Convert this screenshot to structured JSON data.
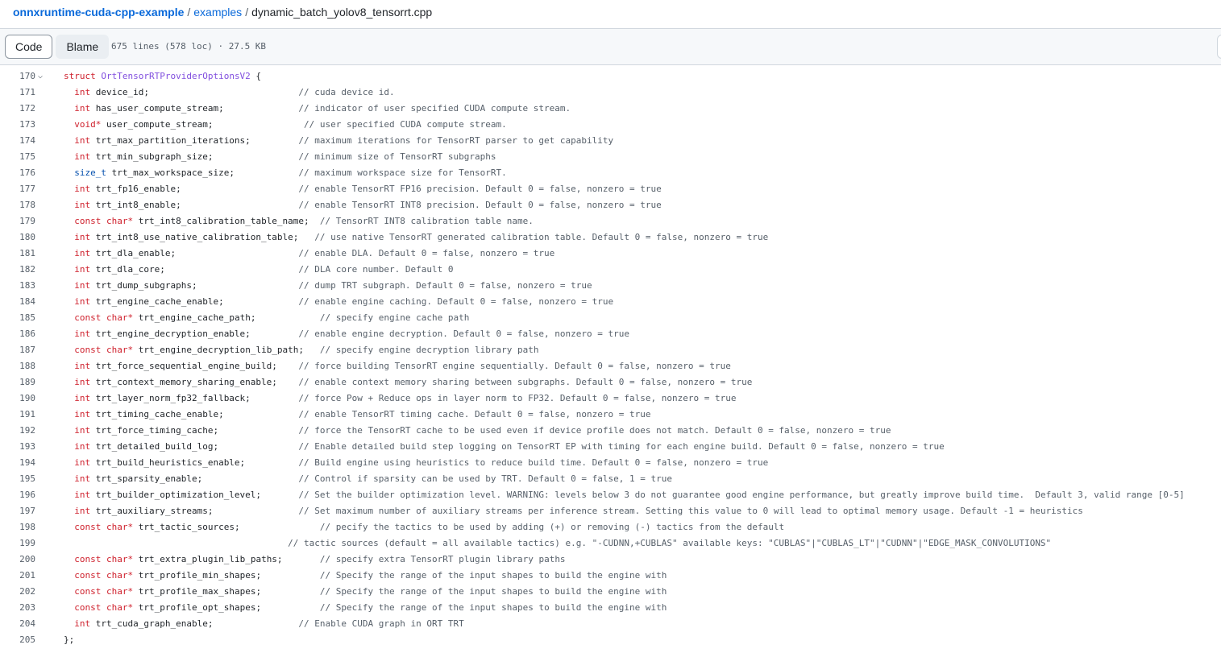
{
  "breadcrumb": {
    "repo": "onnxruntime-cuda-cpp-example",
    "separator": "/",
    "folder": "examples",
    "file": "dynamic_batch_yolov8_tensorrt.cpp"
  },
  "toolbar": {
    "code_label": "Code",
    "blame_label": "Blame",
    "file_meta": "675 lines (578 loc) · 27.5 KB"
  },
  "icons": {
    "fold": "chevron-down-icon"
  },
  "colors": {
    "keyword": "#cf222e",
    "entity": "#8250df",
    "type": "#0550ae",
    "comment": "#57606a",
    "link": "#0969da"
  },
  "code": {
    "lines": [
      {
        "n": "170",
        "tokens": [
          [
            "kw",
            "struct"
          ],
          [
            "t",
            " "
          ],
          [
            "ent",
            "OrtTensorRTProviderOptionsV2"
          ],
          [
            "t",
            " {"
          ]
        ]
      },
      {
        "n": "171",
        "tokens": [
          [
            "t",
            "  "
          ],
          [
            "kw",
            "int"
          ],
          [
            "t",
            " device_id;                            "
          ],
          [
            "cmt",
            "// cuda device id."
          ]
        ]
      },
      {
        "n": "172",
        "tokens": [
          [
            "t",
            "  "
          ],
          [
            "kw",
            "int"
          ],
          [
            "t",
            " has_user_compute_stream;              "
          ],
          [
            "cmt",
            "// indicator of user specified CUDA compute stream."
          ]
        ]
      },
      {
        "n": "173",
        "tokens": [
          [
            "t",
            "  "
          ],
          [
            "kw",
            "void"
          ],
          [
            "kw",
            "*"
          ],
          [
            "t",
            " user_compute_stream;                 "
          ],
          [
            "cmt",
            "// user specified CUDA compute stream."
          ]
        ]
      },
      {
        "n": "174",
        "tokens": [
          [
            "t",
            "  "
          ],
          [
            "kw",
            "int"
          ],
          [
            "t",
            " trt_max_partition_iterations;         "
          ],
          [
            "cmt",
            "// maximum iterations for TensorRT parser to get capability"
          ]
        ]
      },
      {
        "n": "175",
        "tokens": [
          [
            "t",
            "  "
          ],
          [
            "kw",
            "int"
          ],
          [
            "t",
            " trt_min_subgraph_size;                "
          ],
          [
            "cmt",
            "// minimum size of TensorRT subgraphs"
          ]
        ]
      },
      {
        "n": "176",
        "tokens": [
          [
            "t",
            "  "
          ],
          [
            "typ",
            "size_t"
          ],
          [
            "t",
            " trt_max_workspace_size;            "
          ],
          [
            "cmt",
            "// maximum workspace size for TensorRT."
          ]
        ]
      },
      {
        "n": "177",
        "tokens": [
          [
            "t",
            "  "
          ],
          [
            "kw",
            "int"
          ],
          [
            "t",
            " trt_fp16_enable;                      "
          ],
          [
            "cmt",
            "// enable TensorRT FP16 precision. Default 0 = false, nonzero = true"
          ]
        ]
      },
      {
        "n": "178",
        "tokens": [
          [
            "t",
            "  "
          ],
          [
            "kw",
            "int"
          ],
          [
            "t",
            " trt_int8_enable;                      "
          ],
          [
            "cmt",
            "// enable TensorRT INT8 precision. Default 0 = false, nonzero = true"
          ]
        ]
      },
      {
        "n": "179",
        "tokens": [
          [
            "t",
            "  "
          ],
          [
            "kw",
            "const"
          ],
          [
            "t",
            " "
          ],
          [
            "kw",
            "char"
          ],
          [
            "kw",
            "*"
          ],
          [
            "t",
            " trt_int8_calibration_table_name;  "
          ],
          [
            "cmt",
            "// TensorRT INT8 calibration table name."
          ]
        ]
      },
      {
        "n": "180",
        "tokens": [
          [
            "t",
            "  "
          ],
          [
            "kw",
            "int"
          ],
          [
            "t",
            " trt_int8_use_native_calibration_table;   "
          ],
          [
            "cmt",
            "// use native TensorRT generated calibration table. Default 0 = false, nonzero = true"
          ]
        ]
      },
      {
        "n": "181",
        "tokens": [
          [
            "t",
            "  "
          ],
          [
            "kw",
            "int"
          ],
          [
            "t",
            " trt_dla_enable;                       "
          ],
          [
            "cmt",
            "// enable DLA. Default 0 = false, nonzero = true"
          ]
        ]
      },
      {
        "n": "182",
        "tokens": [
          [
            "t",
            "  "
          ],
          [
            "kw",
            "int"
          ],
          [
            "t",
            " trt_dla_core;                         "
          ],
          [
            "cmt",
            "// DLA core number. Default 0"
          ]
        ]
      },
      {
        "n": "183",
        "tokens": [
          [
            "t",
            "  "
          ],
          [
            "kw",
            "int"
          ],
          [
            "t",
            " trt_dump_subgraphs;                   "
          ],
          [
            "cmt",
            "// dump TRT subgraph. Default 0 = false, nonzero = true"
          ]
        ]
      },
      {
        "n": "184",
        "tokens": [
          [
            "t",
            "  "
          ],
          [
            "kw",
            "int"
          ],
          [
            "t",
            " trt_engine_cache_enable;              "
          ],
          [
            "cmt",
            "// enable engine caching. Default 0 = false, nonzero = true"
          ]
        ]
      },
      {
        "n": "185",
        "tokens": [
          [
            "t",
            "  "
          ],
          [
            "kw",
            "const"
          ],
          [
            "t",
            " "
          ],
          [
            "kw",
            "char"
          ],
          [
            "kw",
            "*"
          ],
          [
            "t",
            " trt_engine_cache_path;            "
          ],
          [
            "cmt",
            "// specify engine cache path"
          ]
        ]
      },
      {
        "n": "186",
        "tokens": [
          [
            "t",
            "  "
          ],
          [
            "kw",
            "int"
          ],
          [
            "t",
            " trt_engine_decryption_enable;         "
          ],
          [
            "cmt",
            "// enable engine decryption. Default 0 = false, nonzero = true"
          ]
        ]
      },
      {
        "n": "187",
        "tokens": [
          [
            "t",
            "  "
          ],
          [
            "kw",
            "const"
          ],
          [
            "t",
            " "
          ],
          [
            "kw",
            "char"
          ],
          [
            "kw",
            "*"
          ],
          [
            "t",
            " trt_engine_decryption_lib_path;   "
          ],
          [
            "cmt",
            "// specify engine decryption library path"
          ]
        ]
      },
      {
        "n": "188",
        "tokens": [
          [
            "t",
            "  "
          ],
          [
            "kw",
            "int"
          ],
          [
            "t",
            " trt_force_sequential_engine_build;    "
          ],
          [
            "cmt",
            "// force building TensorRT engine sequentially. Default 0 = false, nonzero = true"
          ]
        ]
      },
      {
        "n": "189",
        "tokens": [
          [
            "t",
            "  "
          ],
          [
            "kw",
            "int"
          ],
          [
            "t",
            " trt_context_memory_sharing_enable;    "
          ],
          [
            "cmt",
            "// enable context memory sharing between subgraphs. Default 0 = false, nonzero = true"
          ]
        ]
      },
      {
        "n": "190",
        "tokens": [
          [
            "t",
            "  "
          ],
          [
            "kw",
            "int"
          ],
          [
            "t",
            " trt_layer_norm_fp32_fallback;         "
          ],
          [
            "cmt",
            "// force Pow + Reduce ops in layer norm to FP32. Default 0 = false, nonzero = true"
          ]
        ]
      },
      {
        "n": "191",
        "tokens": [
          [
            "t",
            "  "
          ],
          [
            "kw",
            "int"
          ],
          [
            "t",
            " trt_timing_cache_enable;              "
          ],
          [
            "cmt",
            "// enable TensorRT timing cache. Default 0 = false, nonzero = true"
          ]
        ]
      },
      {
        "n": "192",
        "tokens": [
          [
            "t",
            "  "
          ],
          [
            "kw",
            "int"
          ],
          [
            "t",
            " trt_force_timing_cache;               "
          ],
          [
            "cmt",
            "// force the TensorRT cache to be used even if device profile does not match. Default 0 = false, nonzero = true"
          ]
        ]
      },
      {
        "n": "193",
        "tokens": [
          [
            "t",
            "  "
          ],
          [
            "kw",
            "int"
          ],
          [
            "t",
            " trt_detailed_build_log;               "
          ],
          [
            "cmt",
            "// Enable detailed build step logging on TensorRT EP with timing for each engine build. Default 0 = false, nonzero = true"
          ]
        ]
      },
      {
        "n": "194",
        "tokens": [
          [
            "t",
            "  "
          ],
          [
            "kw",
            "int"
          ],
          [
            "t",
            " trt_build_heuristics_enable;          "
          ],
          [
            "cmt",
            "// Build engine using heuristics to reduce build time. Default 0 = false, nonzero = true"
          ]
        ]
      },
      {
        "n": "195",
        "tokens": [
          [
            "t",
            "  "
          ],
          [
            "kw",
            "int"
          ],
          [
            "t",
            " trt_sparsity_enable;                  "
          ],
          [
            "cmt",
            "// Control if sparsity can be used by TRT. Default 0 = false, 1 = true"
          ]
        ]
      },
      {
        "n": "196",
        "tokens": [
          [
            "t",
            "  "
          ],
          [
            "kw",
            "int"
          ],
          [
            "t",
            " trt_builder_optimization_level;       "
          ],
          [
            "cmt",
            "// Set the builder optimization level. WARNING: levels below 3 do not guarantee good engine performance, but greatly improve build time.  Default 3, valid range [0-5]"
          ]
        ]
      },
      {
        "n": "197",
        "tokens": [
          [
            "t",
            "  "
          ],
          [
            "kw",
            "int"
          ],
          [
            "t",
            " trt_auxiliary_streams;                "
          ],
          [
            "cmt",
            "// Set maximum number of auxiliary streams per inference stream. Setting this value to 0 will lead to optimal memory usage. Default -1 = heuristics"
          ]
        ]
      },
      {
        "n": "198",
        "tokens": [
          [
            "t",
            "  "
          ],
          [
            "kw",
            "const"
          ],
          [
            "t",
            " "
          ],
          [
            "kw",
            "char"
          ],
          [
            "kw",
            "*"
          ],
          [
            "t",
            " trt_tactic_sources;               "
          ],
          [
            "cmt",
            "// pecify the tactics to be used by adding (+) or removing (-) tactics from the default"
          ]
        ]
      },
      {
        "n": "199",
        "tokens": [
          [
            "t",
            "                                          "
          ],
          [
            "cmt",
            "// tactic sources (default = all available tactics) e.g. \"-CUDNN,+CUBLAS\" available keys: \"CUBLAS\"|\"CUBLAS_LT\"|\"CUDNN\"|\"EDGE_MASK_CONVOLUTIONS\""
          ]
        ]
      },
      {
        "n": "200",
        "tokens": [
          [
            "t",
            "  "
          ],
          [
            "kw",
            "const"
          ],
          [
            "t",
            " "
          ],
          [
            "kw",
            "char"
          ],
          [
            "kw",
            "*"
          ],
          [
            "t",
            " trt_extra_plugin_lib_paths;       "
          ],
          [
            "cmt",
            "// specify extra TensorRT plugin library paths"
          ]
        ]
      },
      {
        "n": "201",
        "tokens": [
          [
            "t",
            "  "
          ],
          [
            "kw",
            "const"
          ],
          [
            "t",
            " "
          ],
          [
            "kw",
            "char"
          ],
          [
            "kw",
            "*"
          ],
          [
            "t",
            " trt_profile_min_shapes;           "
          ],
          [
            "cmt",
            "// Specify the range of the input shapes to build the engine with"
          ]
        ]
      },
      {
        "n": "202",
        "tokens": [
          [
            "t",
            "  "
          ],
          [
            "kw",
            "const"
          ],
          [
            "t",
            " "
          ],
          [
            "kw",
            "char"
          ],
          [
            "kw",
            "*"
          ],
          [
            "t",
            " trt_profile_max_shapes;           "
          ],
          [
            "cmt",
            "// Specify the range of the input shapes to build the engine with"
          ]
        ]
      },
      {
        "n": "203",
        "tokens": [
          [
            "t",
            "  "
          ],
          [
            "kw",
            "const"
          ],
          [
            "t",
            " "
          ],
          [
            "kw",
            "char"
          ],
          [
            "kw",
            "*"
          ],
          [
            "t",
            " trt_profile_opt_shapes;           "
          ],
          [
            "cmt",
            "// Specify the range of the input shapes to build the engine with"
          ]
        ]
      },
      {
        "n": "204",
        "tokens": [
          [
            "t",
            "  "
          ],
          [
            "kw",
            "int"
          ],
          [
            "t",
            " trt_cuda_graph_enable;                "
          ],
          [
            "cmt",
            "// Enable CUDA graph in ORT TRT"
          ]
        ]
      },
      {
        "n": "205",
        "tokens": [
          [
            "t",
            "};"
          ]
        ]
      }
    ]
  }
}
